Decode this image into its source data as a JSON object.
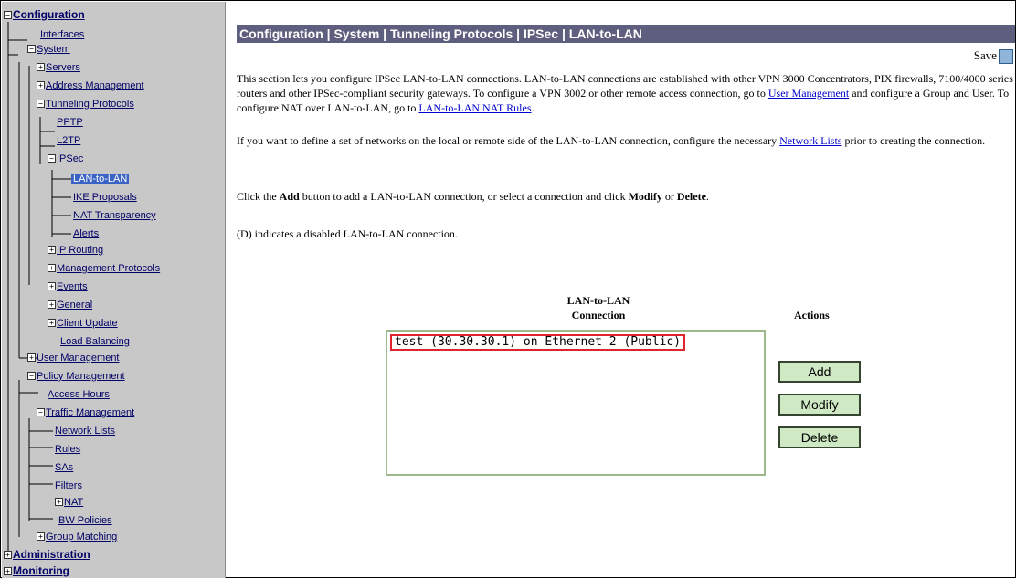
{
  "tree": {
    "configuration": "Configuration",
    "interfaces": "Interfaces",
    "system": "System",
    "servers": "Servers",
    "address_management": "Address Management",
    "tunneling_protocols": "Tunneling Protocols",
    "pptp": "PPTP",
    "l2tp": "L2TP",
    "ipsec": "IPSec",
    "lan_to_lan": "LAN-to-LAN",
    "ike_proposals": "IKE Proposals",
    "nat_transparency": "NAT Transparency",
    "alerts": "Alerts",
    "ip_routing": "IP Routing",
    "management_protocols": "Management Protocols",
    "events": "Events",
    "general": "General",
    "client_update": "Client Update",
    "load_balancing": "Load Balancing",
    "user_management": "User Management",
    "policy_management": "Policy Management",
    "access_hours": "Access Hours",
    "traffic_management": "Traffic Management",
    "network_lists": "Network Lists",
    "rules": "Rules",
    "sas": "SAs",
    "filters": "Filters",
    "nat": "NAT",
    "bw_policies": "BW Policies",
    "group_matching": "Group Matching",
    "administration": "Administration",
    "monitoring": "Monitoring"
  },
  "header": {
    "breadcrumb": "Configuration | System | Tunneling Protocols | IPSec | LAN-to-LAN",
    "save": "Save"
  },
  "intro": {
    "p1_a": "This section lets you configure IPSec LAN-to-LAN connections. LAN-to-LAN connections are established with other VPN 3000 Concentrators, PIX firewalls, 7100/4000 series routers and other IPSec-compliant security gateways. To configure a VPN 3002 or other remote access connection, go to ",
    "link_user_management": "User Management",
    "p1_b": " and configure a Group and User. To configure NAT over LAN-to-LAN, go to ",
    "link_nat_rules": "LAN-to-LAN NAT Rules",
    "p1_c": ".",
    "p2_a": "If you want to define a set of networks on the local or remote side of the LAN-to-LAN connection, configure the necessary ",
    "link_network_lists": "Network Lists",
    "p2_b": " prior to creating the connection.",
    "p3_a": "Click the ",
    "p3_add": "Add",
    "p3_b": " button to add a LAN-to-LAN connection, or select a connection and click ",
    "p3_modify": "Modify",
    "p3_c": " or ",
    "p3_delete": "Delete",
    "p3_d": ".",
    "p4": "(D) indicates a disabled LAN-to-LAN connection."
  },
  "connections": {
    "header_line1": "LAN-to-LAN",
    "header_line2": "Connection",
    "items": [
      "test (30.30.30.1) on Ethernet 2 (Public)"
    ]
  },
  "actions": {
    "header": "Actions",
    "add": "Add",
    "modify": "Modify",
    "delete": "Delete"
  }
}
